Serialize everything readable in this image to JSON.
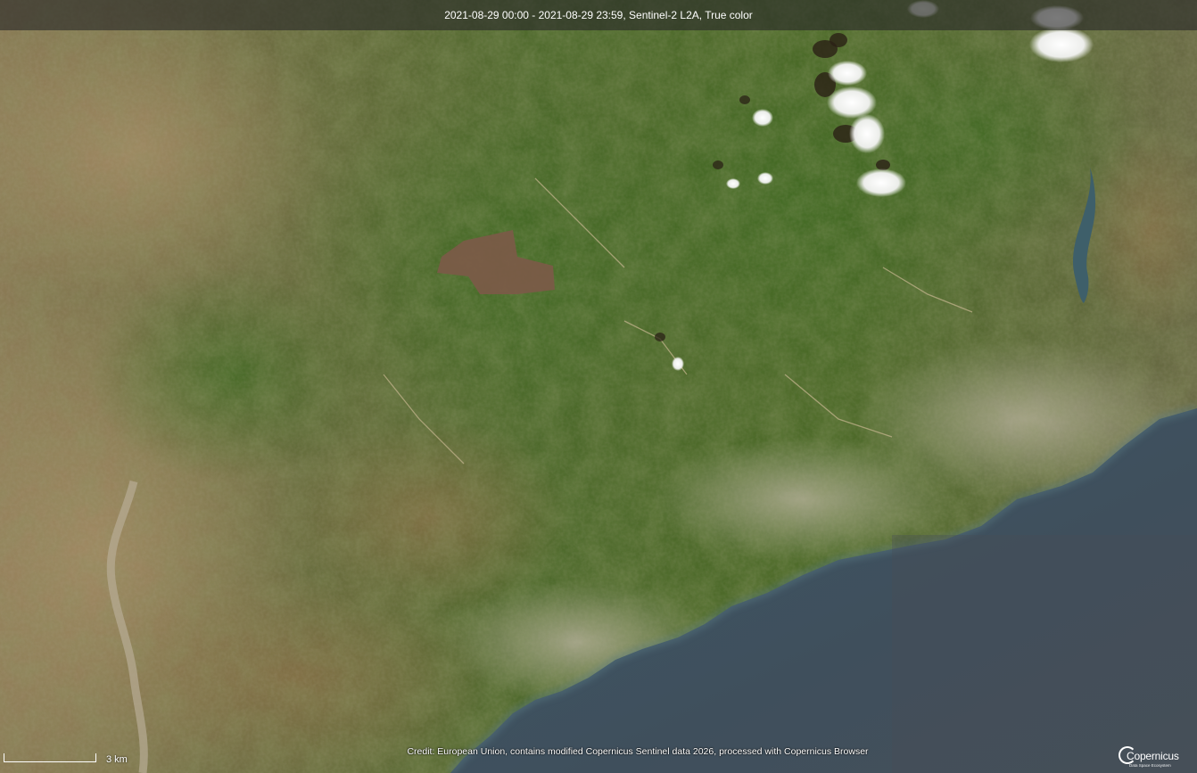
{
  "header": {
    "title": "2021-08-29 00:00 - 2021-08-29 23:59, Sentinel-2 L2A, True color"
  },
  "credit": {
    "text": "Credit: European Union, contains modified Copernicus Sentinel data 2026, processed with Copernicus Browser"
  },
  "scale": {
    "label": "3 km"
  },
  "logo": {
    "name": "Copernicus",
    "tagline": "Data Space Ecosystem"
  },
  "colors": {
    "sea": "#3e5565",
    "sea_deep": "#414a52",
    "vegetation": "#4a6a2a",
    "dry_land": "#9c8a66",
    "urban": "#b9b2a4",
    "cloud": "#ffffff",
    "burn_scar": "#7c5a48"
  }
}
